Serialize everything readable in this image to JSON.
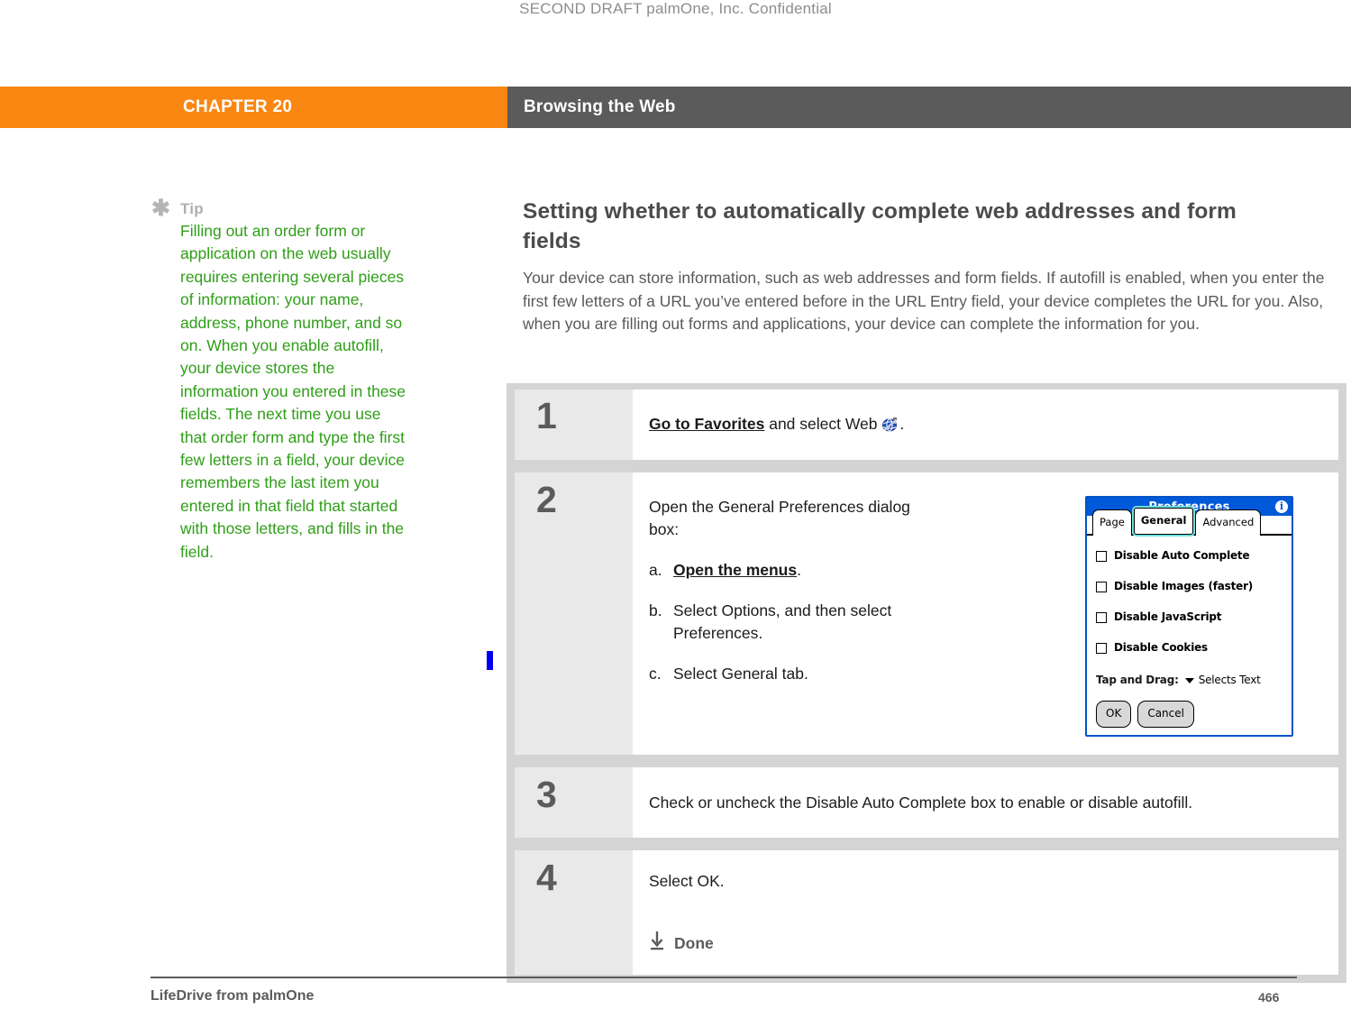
{
  "draft_notice": "SECOND DRAFT palmOne, Inc.  Confidential",
  "header": {
    "chapter": "CHAPTER 20",
    "title": "Browsing the Web",
    "chapter_bg": "#f98712",
    "title_bg": "#5b5b5b"
  },
  "tip": {
    "icon": "asterisk-icon",
    "label": "Tip",
    "color": "#2f9e18",
    "body": "Filling out an order form or application on the web usually requires entering several pieces of information: your name, address, phone number, and so on. When you enable autofill, your device stores the information you entered in these fields. The next time you use that order form and type the first few letters in a field, your device remembers the last item you entered in that field that started with those letters, and fills in the field."
  },
  "section": {
    "title": "Setting whether to automatically complete web addresses and form fields",
    "intro": "Your device can store information, such as web addresses and form fields. If autofill is enabled, when you enter the first few letters of a URL you’ve entered before in the URL Entry field, your device completes the URL for you. Also, when you are filling out forms and applications, your device can complete the information for you."
  },
  "steps": [
    {
      "number": "1",
      "link_text": "Go to Favorites",
      "text_after": " and select Web ",
      "icon": "web-globe-icon",
      "text_end": "."
    },
    {
      "number": "2",
      "lead": "Open the General Preferences dialog box:",
      "substeps": [
        {
          "marker": "a.",
          "bold_text": "Open the menus",
          "plain_text": "."
        },
        {
          "marker": "b.",
          "bold_text": "",
          "plain_text": "Select Options, and then select Preferences."
        },
        {
          "marker": "c.",
          "bold_text": "",
          "plain_text": "Select General tab."
        }
      ]
    },
    {
      "number": "3",
      "text": "Check or uncheck the Disable Auto Complete box to enable or disable autofill."
    },
    {
      "number": "4",
      "text": "Select OK.",
      "done_label": "Done",
      "done_icon": "down-arrow-to-bar-icon"
    }
  ],
  "prefs_dialog": {
    "title": "Preferences",
    "info_badge": "i",
    "titlebar_color": "#0059d8",
    "tabs": [
      {
        "label": "Page",
        "active": false
      },
      {
        "label": "General",
        "active": true
      },
      {
        "label": "Advanced",
        "active": false
      }
    ],
    "checkboxes": [
      {
        "label": "Disable Auto Complete",
        "checked": false
      },
      {
        "label": "Disable Images (faster)",
        "checked": false
      },
      {
        "label": "Disable JavaScript",
        "checked": false
      },
      {
        "label": "Disable Cookies",
        "checked": false
      }
    ],
    "tap_and_drag": {
      "label": "Tap and Drag:",
      "value": "Selects Text"
    },
    "buttons": [
      {
        "label": "OK"
      },
      {
        "label": "Cancel"
      }
    ]
  },
  "footer": {
    "left": "LifeDrive from palmOne",
    "page": "466"
  }
}
